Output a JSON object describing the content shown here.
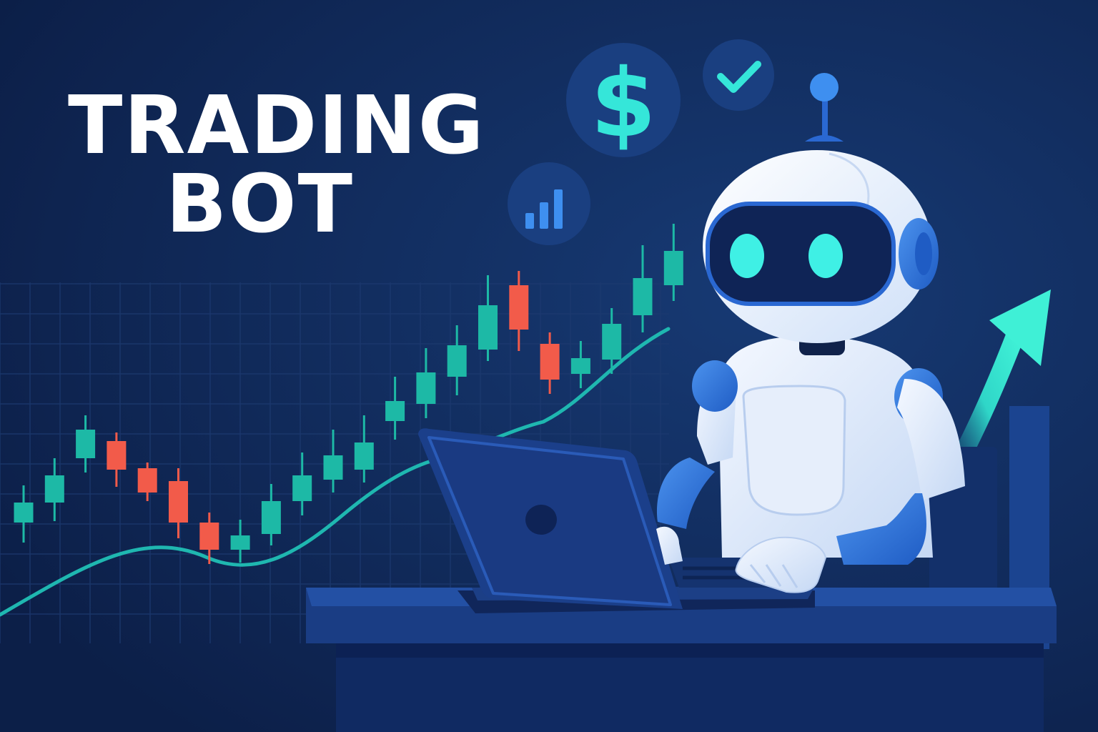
{
  "title": {
    "line1": "TRADING",
    "line2": "BOT"
  },
  "icons": [
    {
      "name": "dollar-icon"
    },
    {
      "name": "check-icon"
    },
    {
      "name": "bar-chart-icon"
    }
  ],
  "chart_data": {
    "type": "candlestick",
    "candles": [
      {
        "o": 46,
        "c": 60,
        "h": 72,
        "l": 32,
        "dir": "up"
      },
      {
        "o": 60,
        "c": 79,
        "h": 91,
        "l": 47,
        "dir": "up"
      },
      {
        "o": 91,
        "c": 111,
        "h": 121,
        "l": 81,
        "dir": "up"
      },
      {
        "o": 103,
        "c": 83,
        "h": 109,
        "l": 71,
        "dir": "down"
      },
      {
        "o": 84,
        "c": 67,
        "h": 88,
        "l": 61,
        "dir": "down"
      },
      {
        "o": 75,
        "c": 46,
        "h": 84,
        "l": 35,
        "dir": "down"
      },
      {
        "o": 46,
        "c": 27,
        "h": 53,
        "l": 17,
        "dir": "down"
      },
      {
        "o": 27,
        "c": 37,
        "h": 48,
        "l": 18,
        "dir": "up"
      },
      {
        "o": 38,
        "c": 61,
        "h": 73,
        "l": 30,
        "dir": "up"
      },
      {
        "o": 61,
        "c": 79,
        "h": 95,
        "l": 51,
        "dir": "up"
      },
      {
        "o": 76,
        "c": 93,
        "h": 111,
        "l": 67,
        "dir": "up"
      },
      {
        "o": 83,
        "c": 102,
        "h": 121,
        "l": 74,
        "dir": "up"
      },
      {
        "o": 117,
        "c": 131,
        "h": 148,
        "l": 104,
        "dir": "up"
      },
      {
        "o": 129,
        "c": 151,
        "h": 168,
        "l": 119,
        "dir": "up"
      },
      {
        "o": 148,
        "c": 170,
        "h": 184,
        "l": 135,
        "dir": "up"
      },
      {
        "o": 167,
        "c": 198,
        "h": 219,
        "l": 159,
        "dir": "up"
      },
      {
        "o": 212,
        "c": 181,
        "h": 222,
        "l": 166,
        "dir": "down"
      },
      {
        "o": 171,
        "c": 146,
        "h": 179,
        "l": 136,
        "dir": "down"
      },
      {
        "o": 150,
        "c": 161,
        "h": 173,
        "l": 140,
        "dir": "up"
      },
      {
        "o": 160,
        "c": 185,
        "h": 196,
        "l": 150,
        "dir": "up"
      },
      {
        "o": 191,
        "c": 217,
        "h": 240,
        "l": 179,
        "dir": "up"
      },
      {
        "o": 212,
        "c": 236,
        "h": 255,
        "l": 201,
        "dir": "up"
      }
    ],
    "colors": {
      "up": "#1db9a6",
      "down": "#f25b4a"
    }
  }
}
